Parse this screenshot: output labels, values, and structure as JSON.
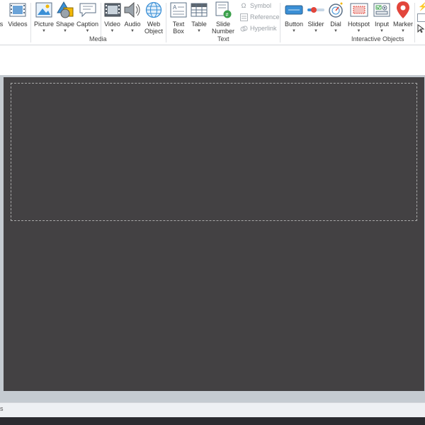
{
  "ribbon": {
    "partial": {
      "videos_label": "Videos",
      "s_label": "s"
    },
    "media": {
      "picture": "Picture",
      "shape": "Shape",
      "caption": "Caption",
      "video": "Video",
      "audio": "Audio",
      "web_object": "Web Object",
      "group_label": "Media"
    },
    "text": {
      "text_box": "Text Box",
      "table": "Table",
      "slide_number": "Slide Number",
      "symbol": "Symbol",
      "reference": "Reference",
      "hyperlink": "Hyperlink",
      "group_label": "Text"
    },
    "interactive": {
      "button": "Button",
      "slider": "Slider",
      "dial": "Dial",
      "hotspot": "Hotspot",
      "input": "Input",
      "marker": "Marker",
      "group_label": "Interactive Objects"
    }
  },
  "status": {
    "text": "s"
  },
  "colors": {
    "slide_bg": "#434143",
    "stage_bg": "#c5cbd1",
    "accent": "#2a7fc7"
  }
}
